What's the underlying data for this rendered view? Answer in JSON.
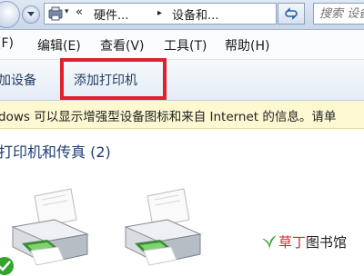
{
  "address_bar": {
    "path_prefix": "«",
    "crumb_1": "硬件...",
    "separator": "▸",
    "crumb_2": "设备和...",
    "search_placeholder": "搜索 设备"
  },
  "menu": {
    "items": [
      "(F)",
      "编辑(E)",
      "查看(V)",
      "工具(T)",
      "帮助(H)"
    ]
  },
  "command_bar": {
    "add_device": "加设备",
    "add_printer": "添加打印机"
  },
  "info_bar": {
    "text": "dows 可以显示增强型设备图标和来自 Internet 的信息。请单"
  },
  "section": {
    "title": "打印机和传真 (2)"
  },
  "watermark": {
    "brand": "草丁",
    "suffix": "图书馆"
  },
  "colors": {
    "highlight": "#e0202a",
    "info_background": "#fdf8d2",
    "section_title": "#1e3c78"
  }
}
